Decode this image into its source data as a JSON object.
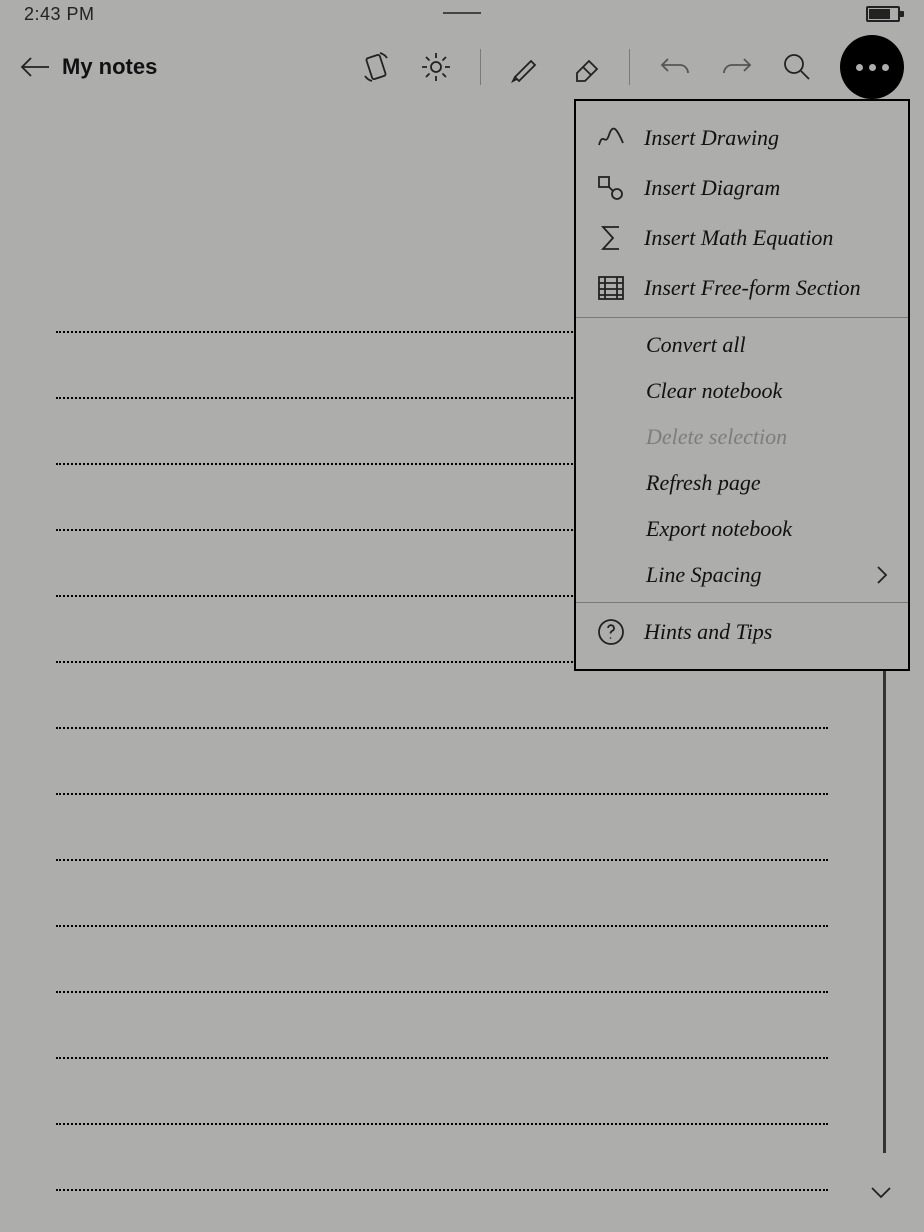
{
  "status_bar": {
    "time": "2:43 PM"
  },
  "header": {
    "title": "My notes"
  },
  "menu": {
    "sections": [
      {
        "items": [
          {
            "icon": "drawing-icon",
            "label": "Insert Drawing",
            "disabled": false
          },
          {
            "icon": "diagram-icon",
            "label": "Insert Diagram",
            "disabled": false
          },
          {
            "icon": "sigma-icon",
            "label": "Insert Math Equation",
            "disabled": false
          },
          {
            "icon": "freeform-icon",
            "label": "Insert Free-form Section",
            "disabled": false
          }
        ]
      },
      {
        "items": [
          {
            "label": "Convert all",
            "disabled": false
          },
          {
            "label": "Clear notebook",
            "disabled": false
          },
          {
            "label": "Delete selection",
            "disabled": true
          },
          {
            "label": "Refresh page",
            "disabled": false
          },
          {
            "label": "Export notebook",
            "disabled": false
          },
          {
            "label": "Line Spacing",
            "disabled": false,
            "submenu": true
          }
        ]
      },
      {
        "items": [
          {
            "icon": "help-icon",
            "label": "Hints and Tips",
            "disabled": false
          }
        ]
      }
    ]
  }
}
